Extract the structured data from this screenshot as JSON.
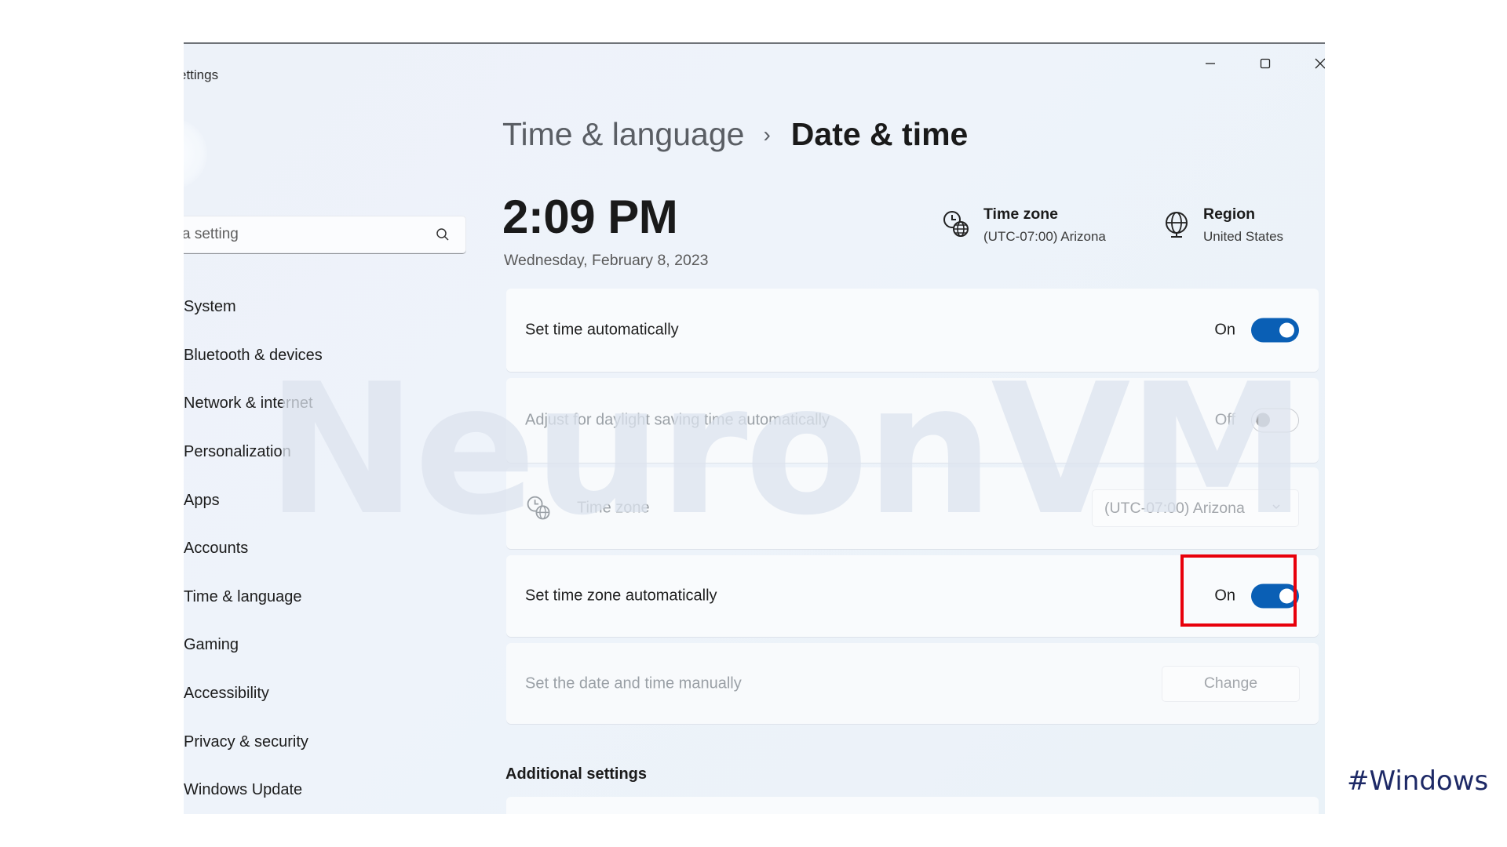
{
  "window": {
    "title": "ettings",
    "controls": {
      "minimize": "minimize",
      "maximize": "maximize",
      "close": "close"
    }
  },
  "search": {
    "placeholder": "a setting"
  },
  "sidebar": {
    "items": [
      {
        "label": "System",
        "selected": false
      },
      {
        "label": "Bluetooth & devices",
        "selected": false
      },
      {
        "label": "Network & internet",
        "selected": false
      },
      {
        "label": "Personalization",
        "selected": false
      },
      {
        "label": "Apps",
        "selected": false
      },
      {
        "label": "Accounts",
        "selected": false
      },
      {
        "label": "Time & language",
        "selected": true
      },
      {
        "label": "Gaming",
        "selected": false
      },
      {
        "label": "Accessibility",
        "selected": false
      },
      {
        "label": "Privacy & security",
        "selected": false
      },
      {
        "label": "Windows Update",
        "selected": false
      }
    ]
  },
  "breadcrumb": {
    "parent": "Time & language",
    "separator": "›",
    "current": "Date & time"
  },
  "clock": {
    "time": "2:09 PM",
    "date": "Wednesday, February 8, 2023"
  },
  "info": {
    "timezone": {
      "title": "Time zone",
      "value": "(UTC-07:00) Arizona",
      "icon": "clock-globe-icon"
    },
    "region": {
      "title": "Region",
      "value": "United States",
      "icon": "globe-icon"
    }
  },
  "settings": {
    "set_time_auto": {
      "label": "Set time automatically",
      "state": "On",
      "on": true
    },
    "daylight_saving": {
      "label": "Adjust for daylight saving time automatically",
      "state": "Off",
      "on": false,
      "disabled": true
    },
    "time_zone": {
      "label": "Time zone",
      "value": "(UTC-07:00) Arizona",
      "disabled": true
    },
    "set_tz_auto": {
      "label": "Set time zone automatically",
      "state": "On",
      "on": true,
      "highlighted": true
    },
    "manual": {
      "label": "Set the date and time manually",
      "button": "Change",
      "disabled": true
    }
  },
  "additional": {
    "title": "Additional settings"
  },
  "overlay": {
    "watermark": "NeuronVM",
    "hashtag": "#Windows",
    "highlight_color": "#e8000b",
    "accent_color": "#0a5fb5"
  }
}
